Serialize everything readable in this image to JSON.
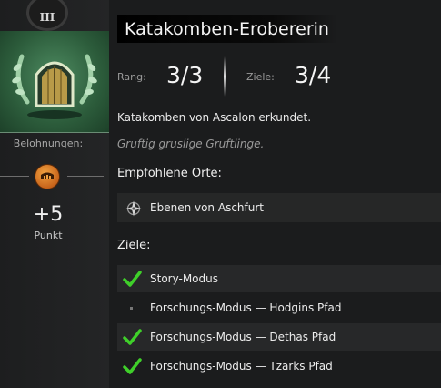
{
  "achievement": {
    "tier": "III",
    "title": "Katakomben-Erobererin",
    "rank_label": "Rang:",
    "rank_value": "3/3",
    "goals_label": "Ziele:",
    "goals_value": "3/4",
    "description": "Katakomben von Ascalon erkundet.",
    "flavor": "Gruftig gruslige Gruftlinge."
  },
  "rewards": {
    "label": "Belohnungen:",
    "value": "+5",
    "unit": "Punkt",
    "icon": "achievement-point-icon"
  },
  "recommended": {
    "heading": "Empfohlene Orte:",
    "locations": [
      {
        "name": "Ebenen von Aschfurt",
        "icon": "compass-waypoint-icon"
      }
    ]
  },
  "objectives": {
    "heading": "Ziele:",
    "items": [
      {
        "label": "Story-Modus",
        "done": true
      },
      {
        "label": "Forschungs-Modus — Hodgins Pfad",
        "done": false
      },
      {
        "label": "Forschungs-Modus — Dethas Pfad",
        "done": true
      },
      {
        "label": "Forschungs-Modus — Tzarks Pfad",
        "done": true
      }
    ]
  },
  "colors": {
    "check": "#3fcf2a",
    "emblem": "#2c5c3b",
    "reward": "#e08a2c"
  }
}
